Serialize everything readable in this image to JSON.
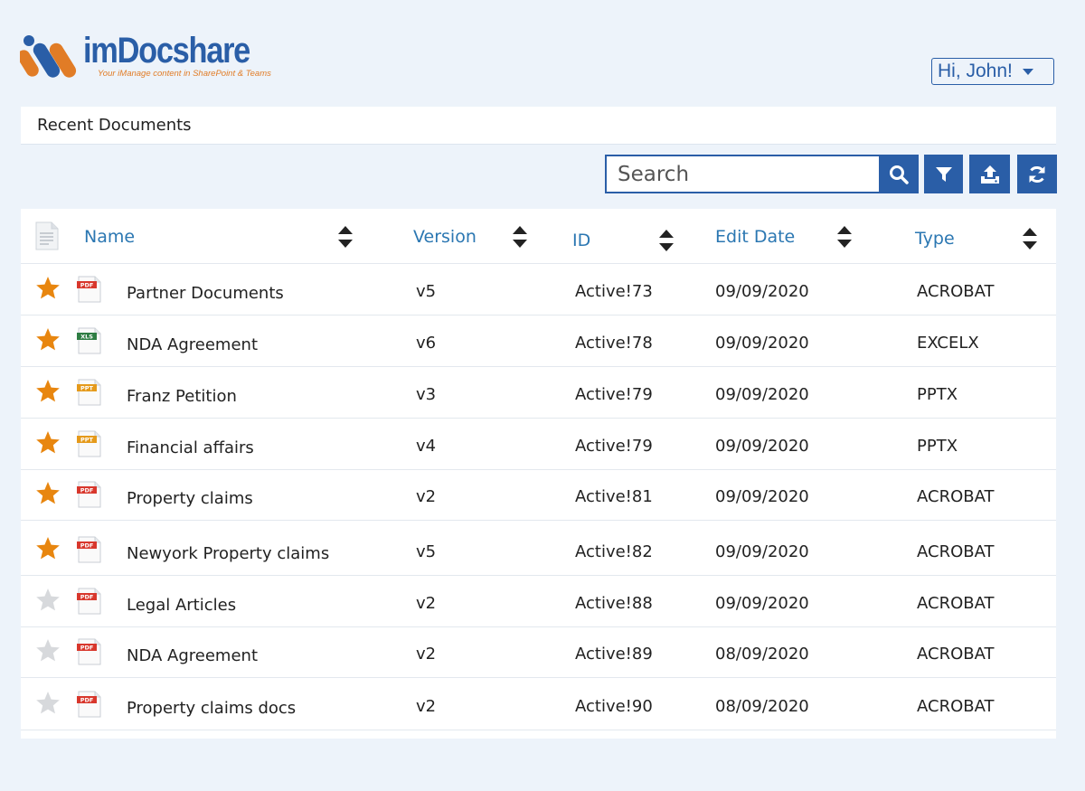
{
  "brand": {
    "name": "imDocshare",
    "tagline": "Your iManage content in SharePoint & Teams",
    "colors": {
      "blue": "#2a5ea7",
      "orange": "#e17c26"
    }
  },
  "user_menu": {
    "label": "Hi, John!"
  },
  "page_title": "Recent Documents",
  "toolbar": {
    "search_placeholder": "Search",
    "buttons": [
      "search-icon",
      "filter-icon",
      "upload-icon",
      "refresh-icon"
    ]
  },
  "table": {
    "columns": [
      "Name",
      "Version",
      "ID",
      "Edit Date",
      "Type"
    ],
    "rows": [
      {
        "starred": true,
        "icon": "PDF",
        "name": "Partner Documents",
        "version": "v5",
        "id": "Active!73",
        "date": "09/09/2020",
        "type": "ACROBAT"
      },
      {
        "starred": true,
        "icon": "XLS",
        "name": "NDA Agreement",
        "version": "v6",
        "id": "Active!78",
        "date": "09/09/2020",
        "type": "EXCELX"
      },
      {
        "starred": true,
        "icon": "PPT",
        "name": "Franz Petition",
        "version": "v3",
        "id": "Active!79",
        "date": "09/09/2020",
        "type": "PPTX"
      },
      {
        "starred": true,
        "icon": "PPT",
        "name": "Financial affairs",
        "version": "v4",
        "id": "Active!79",
        "date": "09/09/2020",
        "type": "PPTX"
      },
      {
        "starred": true,
        "icon": "PDF",
        "name": "Property claims",
        "version": "v2",
        "id": "Active!81",
        "date": "09/09/2020",
        "type": "ACROBAT"
      },
      {
        "starred": true,
        "icon": "PDF",
        "name": "Newyork Property claims",
        "version": "v5",
        "id": "Active!82",
        "date": "09/09/2020",
        "type": "ACROBAT"
      },
      {
        "starred": false,
        "icon": "PDF",
        "name": "Legal Articles",
        "version": "v2",
        "id": "Active!88",
        "date": "09/09/2020",
        "type": "ACROBAT"
      },
      {
        "starred": false,
        "icon": "PDF",
        "name": "NDA Agreement",
        "version": "v2",
        "id": "Active!89",
        "date": "08/09/2020",
        "type": "ACROBAT"
      },
      {
        "starred": false,
        "icon": "PDF",
        "name": "Property claims docs",
        "version": "v2",
        "id": "Active!90",
        "date": "08/09/2020",
        "type": "ACROBAT"
      }
    ],
    "colors": {
      "star_on": "#e8860f",
      "star_off": "#d7d9dc",
      "header_text": "#2b77b2",
      "pdf": "#d8372c",
      "xls": "#2e7d43",
      "ppt": "#e59a1b"
    }
  }
}
